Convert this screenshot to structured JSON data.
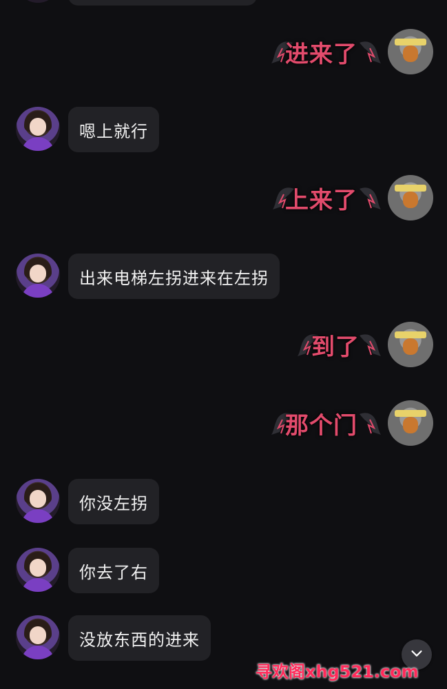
{
  "messages": [
    {
      "side": "right",
      "text": "进来了"
    },
    {
      "side": "left",
      "text": "嗯上就行"
    },
    {
      "side": "right",
      "text": "上来了"
    },
    {
      "side": "left",
      "text": "出来电梯左拐进来在左拐"
    },
    {
      "side": "right",
      "text": "到了"
    },
    {
      "side": "right",
      "text": "那个门"
    },
    {
      "side": "left",
      "text": "你没左拐"
    },
    {
      "side": "left",
      "text": "你去了右"
    },
    {
      "side": "left",
      "text": "没放东西的进来"
    }
  ],
  "overlay": {
    "watermark": "寻欢阁xhg521.com",
    "scroll_down_icon": "chevron-down-icon"
  },
  "colors": {
    "background": "#0f0f12",
    "bubble_left": "#222226",
    "decorated_text": "#e24b6c",
    "watermark": "#ff2a5a"
  }
}
